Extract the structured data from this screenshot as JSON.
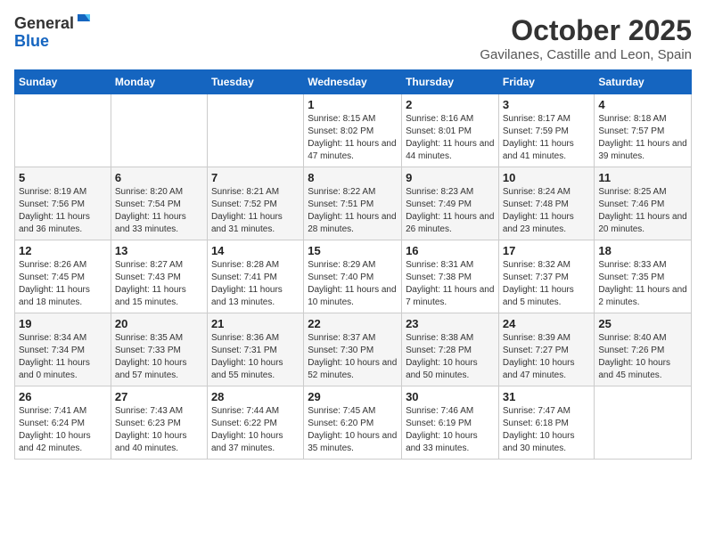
{
  "logo": {
    "line1": "General",
    "line2": "Blue"
  },
  "title": "October 2025",
  "subtitle": "Gavilanes, Castille and Leon, Spain",
  "days_of_week": [
    "Sunday",
    "Monday",
    "Tuesday",
    "Wednesday",
    "Thursday",
    "Friday",
    "Saturday"
  ],
  "weeks": [
    [
      {
        "day": "",
        "info": ""
      },
      {
        "day": "",
        "info": ""
      },
      {
        "day": "",
        "info": ""
      },
      {
        "day": "1",
        "info": "Sunrise: 8:15 AM\nSunset: 8:02 PM\nDaylight: 11 hours and 47 minutes."
      },
      {
        "day": "2",
        "info": "Sunrise: 8:16 AM\nSunset: 8:01 PM\nDaylight: 11 hours and 44 minutes."
      },
      {
        "day": "3",
        "info": "Sunrise: 8:17 AM\nSunset: 7:59 PM\nDaylight: 11 hours and 41 minutes."
      },
      {
        "day": "4",
        "info": "Sunrise: 8:18 AM\nSunset: 7:57 PM\nDaylight: 11 hours and 39 minutes."
      }
    ],
    [
      {
        "day": "5",
        "info": "Sunrise: 8:19 AM\nSunset: 7:56 PM\nDaylight: 11 hours and 36 minutes."
      },
      {
        "day": "6",
        "info": "Sunrise: 8:20 AM\nSunset: 7:54 PM\nDaylight: 11 hours and 33 minutes."
      },
      {
        "day": "7",
        "info": "Sunrise: 8:21 AM\nSunset: 7:52 PM\nDaylight: 11 hours and 31 minutes."
      },
      {
        "day": "8",
        "info": "Sunrise: 8:22 AM\nSunset: 7:51 PM\nDaylight: 11 hours and 28 minutes."
      },
      {
        "day": "9",
        "info": "Sunrise: 8:23 AM\nSunset: 7:49 PM\nDaylight: 11 hours and 26 minutes."
      },
      {
        "day": "10",
        "info": "Sunrise: 8:24 AM\nSunset: 7:48 PM\nDaylight: 11 hours and 23 minutes."
      },
      {
        "day": "11",
        "info": "Sunrise: 8:25 AM\nSunset: 7:46 PM\nDaylight: 11 hours and 20 minutes."
      }
    ],
    [
      {
        "day": "12",
        "info": "Sunrise: 8:26 AM\nSunset: 7:45 PM\nDaylight: 11 hours and 18 minutes."
      },
      {
        "day": "13",
        "info": "Sunrise: 8:27 AM\nSunset: 7:43 PM\nDaylight: 11 hours and 15 minutes."
      },
      {
        "day": "14",
        "info": "Sunrise: 8:28 AM\nSunset: 7:41 PM\nDaylight: 11 hours and 13 minutes."
      },
      {
        "day": "15",
        "info": "Sunrise: 8:29 AM\nSunset: 7:40 PM\nDaylight: 11 hours and 10 minutes."
      },
      {
        "day": "16",
        "info": "Sunrise: 8:31 AM\nSunset: 7:38 PM\nDaylight: 11 hours and 7 minutes."
      },
      {
        "day": "17",
        "info": "Sunrise: 8:32 AM\nSunset: 7:37 PM\nDaylight: 11 hours and 5 minutes."
      },
      {
        "day": "18",
        "info": "Sunrise: 8:33 AM\nSunset: 7:35 PM\nDaylight: 11 hours and 2 minutes."
      }
    ],
    [
      {
        "day": "19",
        "info": "Sunrise: 8:34 AM\nSunset: 7:34 PM\nDaylight: 11 hours and 0 minutes."
      },
      {
        "day": "20",
        "info": "Sunrise: 8:35 AM\nSunset: 7:33 PM\nDaylight: 10 hours and 57 minutes."
      },
      {
        "day": "21",
        "info": "Sunrise: 8:36 AM\nSunset: 7:31 PM\nDaylight: 10 hours and 55 minutes."
      },
      {
        "day": "22",
        "info": "Sunrise: 8:37 AM\nSunset: 7:30 PM\nDaylight: 10 hours and 52 minutes."
      },
      {
        "day": "23",
        "info": "Sunrise: 8:38 AM\nSunset: 7:28 PM\nDaylight: 10 hours and 50 minutes."
      },
      {
        "day": "24",
        "info": "Sunrise: 8:39 AM\nSunset: 7:27 PM\nDaylight: 10 hours and 47 minutes."
      },
      {
        "day": "25",
        "info": "Sunrise: 8:40 AM\nSunset: 7:26 PM\nDaylight: 10 hours and 45 minutes."
      }
    ],
    [
      {
        "day": "26",
        "info": "Sunrise: 7:41 AM\nSunset: 6:24 PM\nDaylight: 10 hours and 42 minutes."
      },
      {
        "day": "27",
        "info": "Sunrise: 7:43 AM\nSunset: 6:23 PM\nDaylight: 10 hours and 40 minutes."
      },
      {
        "day": "28",
        "info": "Sunrise: 7:44 AM\nSunset: 6:22 PM\nDaylight: 10 hours and 37 minutes."
      },
      {
        "day": "29",
        "info": "Sunrise: 7:45 AM\nSunset: 6:20 PM\nDaylight: 10 hours and 35 minutes."
      },
      {
        "day": "30",
        "info": "Sunrise: 7:46 AM\nSunset: 6:19 PM\nDaylight: 10 hours and 33 minutes."
      },
      {
        "day": "31",
        "info": "Sunrise: 7:47 AM\nSunset: 6:18 PM\nDaylight: 10 hours and 30 minutes."
      },
      {
        "day": "",
        "info": ""
      }
    ]
  ]
}
